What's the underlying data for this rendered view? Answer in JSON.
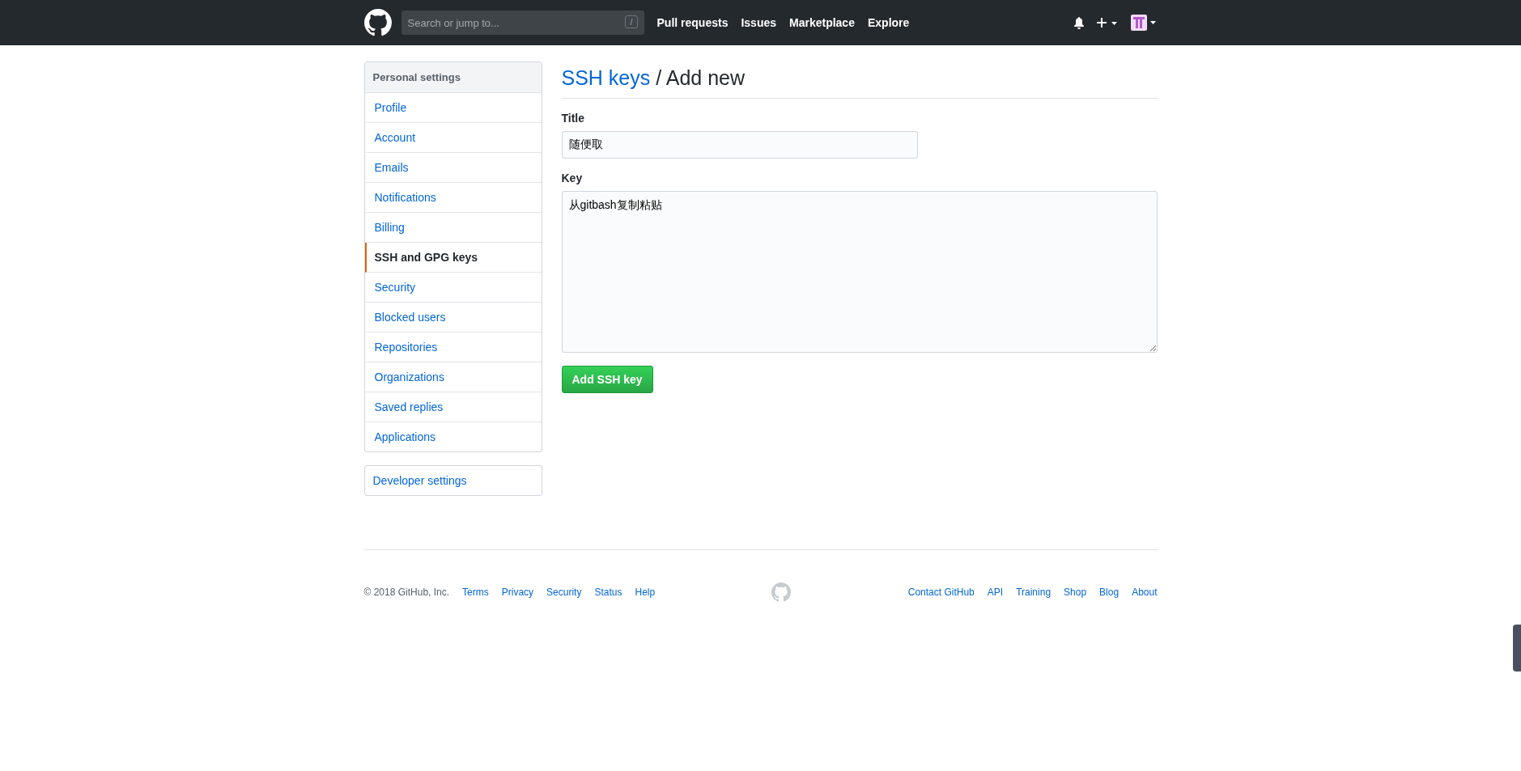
{
  "header": {
    "search": {
      "placeholder": "Search or jump to...",
      "shortcut": "/"
    },
    "nav": [
      "Pull requests",
      "Issues",
      "Marketplace",
      "Explore"
    ]
  },
  "sidebar": {
    "heading": "Personal settings",
    "items": [
      {
        "label": "Profile",
        "selected": false
      },
      {
        "label": "Account",
        "selected": false
      },
      {
        "label": "Emails",
        "selected": false
      },
      {
        "label": "Notifications",
        "selected": false
      },
      {
        "label": "Billing",
        "selected": false
      },
      {
        "label": "SSH and GPG keys",
        "selected": true
      },
      {
        "label": "Security",
        "selected": false
      },
      {
        "label": "Blocked users",
        "selected": false
      },
      {
        "label": "Repositories",
        "selected": false
      },
      {
        "label": "Organizations",
        "selected": false
      },
      {
        "label": "Saved replies",
        "selected": false
      },
      {
        "label": "Applications",
        "selected": false
      }
    ],
    "developer": "Developer settings"
  },
  "page": {
    "breadcrumb": "SSH keys",
    "title": "/ Add new",
    "fields": [
      {
        "label": "Title",
        "value": "随便取",
        "kind": "input"
      },
      {
        "label": "Key",
        "value": "从gitbash复制粘贴",
        "kind": "textarea"
      }
    ],
    "submit": "Add SSH key"
  },
  "footer": {
    "copyright": "© 2018 GitHub, Inc.",
    "left_links": [
      "Terms",
      "Privacy",
      "Security",
      "Status",
      "Help"
    ],
    "right_links": [
      "Contact GitHub",
      "API",
      "Training",
      "Shop",
      "Blog",
      "About"
    ]
  }
}
